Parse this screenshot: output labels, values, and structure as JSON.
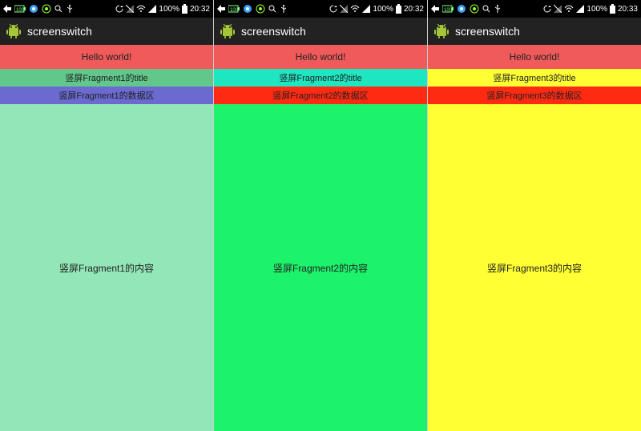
{
  "screens": [
    {
      "status": {
        "battery": "100%",
        "time": "20:32"
      },
      "app": {
        "title": "screenswitch"
      },
      "hello": {
        "text": "Hello world!",
        "bg": "#f05a5a"
      },
      "titlebar": {
        "text": "竖屏Fragment1的title",
        "bg": "#61c78a"
      },
      "databar": {
        "text": "竖屏Fragment1的数据区",
        "bg": "#6a6ad1"
      },
      "content": {
        "text": "竖屏Fragment1的内容",
        "bg": "#93e6b8"
      }
    },
    {
      "status": {
        "battery": "100%",
        "time": "20:32"
      },
      "app": {
        "title": "screenswitch"
      },
      "hello": {
        "text": "Hello world!",
        "bg": "#f05a5a"
      },
      "titlebar": {
        "text": "竖屏Fragment2的title",
        "bg": "#1ee6c1"
      },
      "databar": {
        "text": "竖屏Fragment2的数据区",
        "bg": "#ff2a12"
      },
      "content": {
        "text": "竖屏Fragment2的内容",
        "bg": "#1df26b"
      }
    },
    {
      "status": {
        "battery": "100%",
        "time": "20:33"
      },
      "app": {
        "title": "screenswitch"
      },
      "hello": {
        "text": "Hello world!",
        "bg": "#f05a5a"
      },
      "titlebar": {
        "text": "竖屏Fragment3的title",
        "bg": "#ffff33"
      },
      "databar": {
        "text": "竖屏Fragment3的数据区",
        "bg": "#ff2a12"
      },
      "content": {
        "text": "竖屏Fragment3的内容",
        "bg": "#ffff33"
      }
    }
  ],
  "icons": {
    "arrow": "arrow-icon",
    "batteryBadge": "battery-badge-icon",
    "blueCircle": "blue-circle-icon",
    "greenCircle": "green-circle-icon",
    "search": "search-icon",
    "usb": "usb-icon",
    "refresh": "refresh-icon",
    "noSim": "no-sim-icon",
    "wifi": "wifi-icon",
    "signal": "signal-icon",
    "battery": "battery-icon",
    "android": "android-icon"
  }
}
